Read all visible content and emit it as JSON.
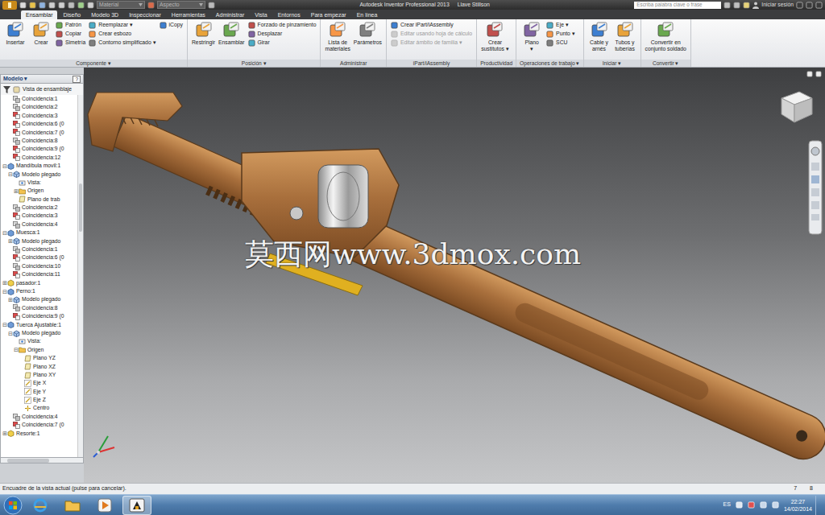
{
  "window": {
    "title": "Autodesk Inventor Professional 2013",
    "document": "Llave Stillson"
  },
  "quick_access": {
    "material": "Material",
    "appearance": "Aspecto"
  },
  "search": {
    "placeholder": "Escriba palabra clave o frase"
  },
  "account": "Iniciar sesión",
  "tabs": [
    {
      "label": "Ensamblar",
      "selected": true
    },
    {
      "label": "Diseño",
      "selected": false
    },
    {
      "label": "Modelo 3D",
      "selected": false
    },
    {
      "label": "Inspeccionar",
      "selected": false
    },
    {
      "label": "Herramientas",
      "selected": false
    },
    {
      "label": "Administrar",
      "selected": false
    },
    {
      "label": "Vista",
      "selected": false
    },
    {
      "label": "Entornos",
      "selected": false
    },
    {
      "label": "Para empezar",
      "selected": false
    },
    {
      "label": "En línea",
      "selected": false
    }
  ],
  "ribbon": {
    "panels": [
      {
        "title": "Componente ▾",
        "items": [
          {
            "label": "Insertar",
            "kind": "large",
            "disabled": false
          },
          {
            "label": "Crear",
            "kind": "large",
            "disabled": false
          },
          {
            "label": "Patrón",
            "kind": "small",
            "disabled": false
          },
          {
            "label": "Copiar",
            "kind": "small",
            "disabled": false
          },
          {
            "label": "Simetría",
            "kind": "small",
            "disabled": false
          },
          {
            "label": "Reemplazar ▾",
            "kind": "small",
            "disabled": false
          },
          {
            "label": "Crear esbozo",
            "kind": "small",
            "disabled": false
          },
          {
            "label": "Contorno simplificado ▾",
            "kind": "small",
            "disabled": false
          },
          {
            "label": "iCopy",
            "kind": "small",
            "disabled": false
          }
        ]
      },
      {
        "title": "Posición ▾",
        "items": [
          {
            "label": "Restringir",
            "kind": "large",
            "disabled": false
          },
          {
            "label": "Ensamblar",
            "kind": "large",
            "disabled": false
          },
          {
            "label": "Forzado de pinzamiento",
            "kind": "small",
            "disabled": false
          },
          {
            "label": "Desplazar",
            "kind": "small",
            "disabled": false
          },
          {
            "label": "Girar",
            "kind": "small",
            "disabled": false
          }
        ]
      },
      {
        "title": "Administrar",
        "items": [
          {
            "label": "Lista de\nmateriales",
            "kind": "large",
            "disabled": false
          },
          {
            "label": "Parámetros",
            "kind": "large",
            "disabled": false
          }
        ]
      },
      {
        "title": "iPart/iAssembly",
        "items": [
          {
            "label": "Crear iPart/iAssembly",
            "kind": "small",
            "disabled": false
          },
          {
            "label": "Editar usando hoja de cálculo",
            "kind": "small",
            "disabled": true
          },
          {
            "label": "Editar ámbito de familia ▾",
            "kind": "small",
            "disabled": true
          }
        ]
      },
      {
        "title": "Productividad",
        "items": [
          {
            "label": "Crear\nsustitutos ▾",
            "kind": "large",
            "disabled": false
          }
        ]
      },
      {
        "title": "Operaciones de trabajo ▾",
        "items": [
          {
            "label": "Plano\n▾",
            "kind": "large",
            "disabled": false
          },
          {
            "label": "Eje ▾",
            "kind": "small",
            "disabled": false
          },
          {
            "label": "Punto ▾",
            "kind": "small",
            "disabled": false
          },
          {
            "label": "SCU",
            "kind": "small",
            "disabled": false
          }
        ]
      },
      {
        "title": "Iniciar ▾",
        "items": [
          {
            "label": "Cable y\narnés",
            "kind": "large",
            "disabled": false
          },
          {
            "label": "Tubos y\ntuberías",
            "kind": "large",
            "disabled": false
          }
        ]
      },
      {
        "title": "Convertir ▾",
        "items": [
          {
            "label": "Convertir en\nconjunto soldado",
            "kind": "large",
            "disabled": false
          }
        ]
      }
    ]
  },
  "browser": {
    "title": "Modelo ▾",
    "help": "?",
    "view": "Vista de ensamblaje",
    "items": [
      {
        "label": "Coincidencia:1",
        "level": 2,
        "kind": "mate"
      },
      {
        "label": "Coincidencia:2",
        "level": 2,
        "kind": "mate"
      },
      {
        "label": "Coincidencia:3",
        "level": 2,
        "kind": "mate-red"
      },
      {
        "label": "Coincidencia:6 (0",
        "level": 2,
        "kind": "mate-red"
      },
      {
        "label": "Coincidencia:7 (0",
        "level": 2,
        "kind": "mate-red"
      },
      {
        "label": "Coincidencia:8",
        "level": 2,
        "kind": "mate"
      },
      {
        "label": "Coincidencia:9 (0",
        "level": 2,
        "kind": "mate-red"
      },
      {
        "label": "Coincidencia:12",
        "level": 2,
        "kind": "mate-red"
      },
      {
        "label": "Mandíbula movil:1",
        "level": 1,
        "kind": "part",
        "toggle": "⊟",
        "expanded": true
      },
      {
        "label": "Modelo plegado",
        "level": 2,
        "kind": "folded",
        "toggle": "⊟",
        "expanded": true
      },
      {
        "label": "Vista:",
        "level": 3,
        "kind": "view"
      },
      {
        "label": "Origen",
        "level": 3,
        "kind": "folder",
        "toggle": "⊞",
        "expanded": false
      },
      {
        "label": "Plano de trab",
        "level": 3,
        "kind": "plane"
      },
      {
        "label": "Coincidencia:2",
        "level": 2,
        "kind": "mate"
      },
      {
        "label": "Coincidencia:3",
        "level": 2,
        "kind": "mate-red"
      },
      {
        "label": "Coincidencia:4",
        "level": 2,
        "kind": "mate"
      },
      {
        "label": "Muesca:1",
        "level": 1,
        "kind": "part",
        "toggle": "⊟",
        "expanded": true
      },
      {
        "label": "Modelo plegado",
        "level": 2,
        "kind": "folded",
        "toggle": "⊞",
        "expanded": false
      },
      {
        "label": "Coincidencia:1",
        "level": 2,
        "kind": "mate"
      },
      {
        "label": "Coincidencia:6 (0",
        "level": 2,
        "kind": "mate-red"
      },
      {
        "label": "Coincidencia:10",
        "level": 2,
        "kind": "mate"
      },
      {
        "label": "Coincidencia:11",
        "level": 2,
        "kind": "mate-red"
      },
      {
        "label": "pasador:1",
        "level": 1,
        "kind": "part-yellow",
        "toggle": "⊞",
        "expanded": false
      },
      {
        "label": "Perno:1",
        "level": 1,
        "kind": "part",
        "toggle": "⊟",
        "expanded": true
      },
      {
        "label": "Modelo plegado",
        "level": 2,
        "kind": "folded",
        "toggle": "⊞",
        "expanded": false
      },
      {
        "label": "Coincidencia:8",
        "level": 2,
        "kind": "mate"
      },
      {
        "label": "Coincidencia:9 (0",
        "level": 2,
        "kind": "mate-red"
      },
      {
        "label": "Tuerca Ajustable:1",
        "level": 1,
        "kind": "part",
        "toggle": "⊟",
        "expanded": true
      },
      {
        "label": "Modelo plegado",
        "level": 2,
        "kind": "folded",
        "toggle": "⊟",
        "expanded": true
      },
      {
        "label": "Vista:",
        "level": 3,
        "kind": "view"
      },
      {
        "label": "Origen",
        "level": 3,
        "kind": "folder",
        "toggle": "⊟",
        "expanded": true
      },
      {
        "label": "Plano YZ",
        "level": 4,
        "kind": "plane"
      },
      {
        "label": "Plano XZ",
        "level": 4,
        "kind": "plane"
      },
      {
        "label": "Plano XY",
        "level": 4,
        "kind": "plane"
      },
      {
        "label": "Eje X",
        "level": 4,
        "kind": "axis"
      },
      {
        "label": "Eje Y",
        "level": 4,
        "kind": "axis"
      },
      {
        "label": "Eje Z",
        "level": 4,
        "kind": "axis"
      },
      {
        "label": "Centro",
        "level": 4,
        "kind": "point"
      },
      {
        "label": "Coincidencia:4",
        "level": 2,
        "kind": "mate"
      },
      {
        "label": "Coincidencia:7 (0",
        "level": 2,
        "kind": "mate-red"
      },
      {
        "label": "Resorte:1",
        "level": 1,
        "kind": "part-yellow",
        "toggle": "⊞",
        "expanded": false
      }
    ]
  },
  "viewport": {
    "watermark": "莫西网www.3dmox.com"
  },
  "status_bar": {
    "message": "Encuadre de la vista actual (pulse para cancelar).",
    "counts": [
      "7",
      "8"
    ]
  },
  "taskbar": {
    "language": "ES",
    "time": "22:27",
    "date": "14/02/2014"
  }
}
